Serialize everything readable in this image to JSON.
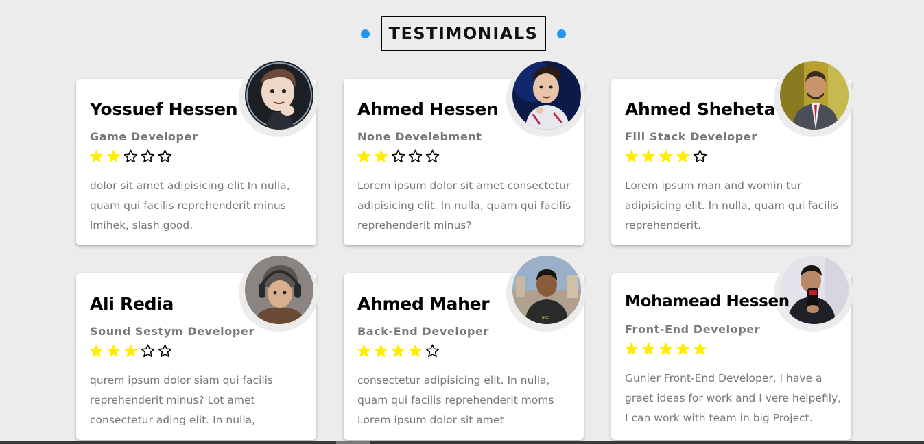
{
  "section": {
    "title": "TESTIMONIALS",
    "accent_color": "#2196f3"
  },
  "star_colors": {
    "filled": "#ffee00",
    "empty_outline": "#000000"
  },
  "testimonials": [
    {
      "name": "Yossuef Hessen",
      "role": "Game Developer",
      "rating": 2,
      "max_rating": 5,
      "text": "dolor sit amet adipisicing elit In nulla, quam qui facilis reprehenderit minus lmihek, slash good.",
      "avatar": "cartoon-avatar"
    },
    {
      "name": "Ahmed Hessen",
      "role": "None Develebment",
      "rating": 2,
      "max_rating": 5,
      "text": "Lorem ipsum dolor sit amet consectetur adipisicing elit. In nulla, quam qui facilis reprehenderit minus?",
      "avatar": "cartoon-avatar"
    },
    {
      "name": "Ahmed Sheheta",
      "role": "Fill Stack Developer",
      "rating": 4,
      "max_rating": 5,
      "text": "Lorem ipsum man and womin tur adipisicing elit. In nulla, quam qui facilis reprehenderit.",
      "avatar": "photo-avatar"
    },
    {
      "name": "Ali Redia",
      "role": "Sound Sestym Developer",
      "rating": 3,
      "max_rating": 5,
      "text": "qurem ipsum dolor siam qui facilis reprehenderit minus? Lot amet consectetur ading elit. In nulla,",
      "avatar": "photo-avatar"
    },
    {
      "name": "Ahmed Maher",
      "role": "Back-End Developer",
      "rating": 4,
      "max_rating": 5,
      "text": "consectetur adipisicing elit. In nulla, quam qui facilis reprehenderit moms Lorem ipsum dolor sit amet",
      "avatar": "photo-avatar"
    },
    {
      "name": "Mohamead Hessen",
      "role": "Front-End Developer",
      "rating": 5,
      "max_rating": 5,
      "text": "Gunier Front-End Developer, I have a graet ideas for work and I vere helpefily, I can work with team in big Project.",
      "avatar": "photo-avatar"
    }
  ]
}
